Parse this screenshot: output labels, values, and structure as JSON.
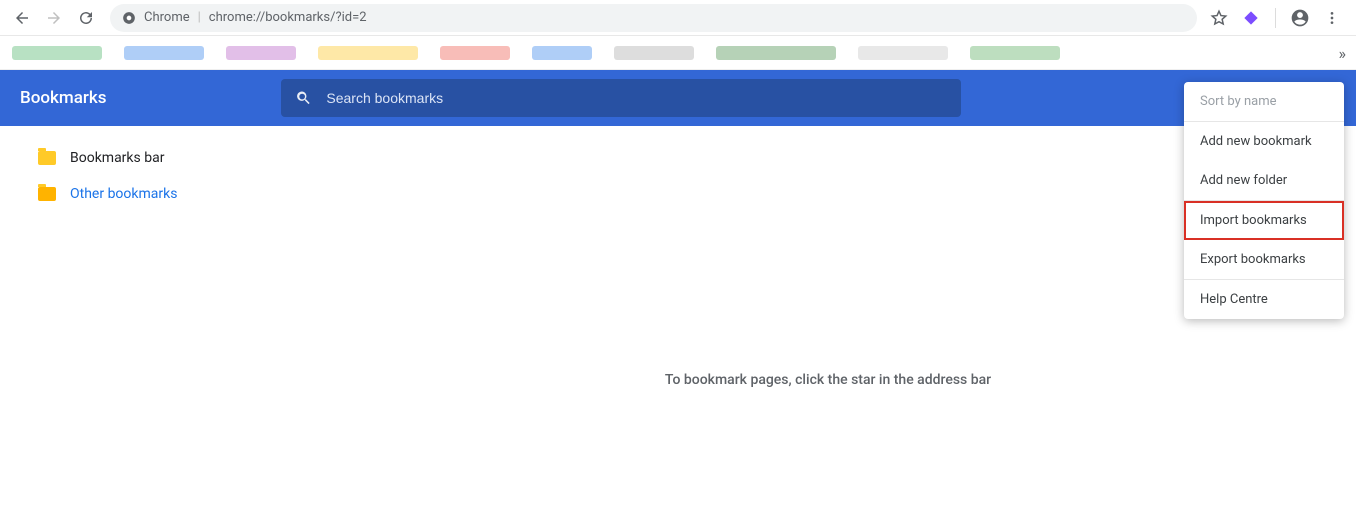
{
  "browser": {
    "address_label": "Chrome",
    "url": "chrome://bookmarks/?id=2"
  },
  "header": {
    "title": "Bookmarks",
    "search_placeholder": "Search bookmarks"
  },
  "sidebar": {
    "items": [
      {
        "label": "Bookmarks bar"
      },
      {
        "label": "Other bookmarks"
      }
    ]
  },
  "main": {
    "empty_message": "To bookmark pages, click the star in the address bar"
  },
  "menu": {
    "sort": "Sort by name",
    "add_bookmark": "Add new bookmark",
    "add_folder": "Add new folder",
    "import": "Import bookmarks",
    "export": "Export bookmarks",
    "help": "Help Centre"
  }
}
